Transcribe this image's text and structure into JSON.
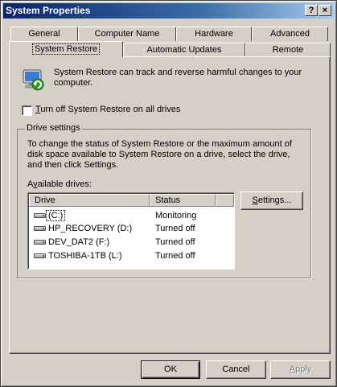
{
  "window": {
    "title": "System Properties",
    "help_glyph": "?",
    "close_glyph": "×"
  },
  "tabs": {
    "row_back": [
      {
        "label": "General"
      },
      {
        "label": "Computer Name"
      },
      {
        "label": "Hardware"
      },
      {
        "label": "Advanced"
      }
    ],
    "row_front": [
      {
        "label": "System Restore",
        "active": true
      },
      {
        "label": "Automatic Updates"
      },
      {
        "label": "Remote"
      }
    ]
  },
  "intro": {
    "icon": "system-restore-icon",
    "text": "System Restore can track and reverse harmful changes to your computer."
  },
  "turn_off": {
    "checked": false,
    "mnemonic": "T",
    "label_rest": "urn off System Restore on all drives"
  },
  "drive_settings": {
    "title": "Drive settings",
    "description": "To change the status of System Restore or the maximum amount of disk space available to System Restore on a drive, select the drive, and then click Settings.",
    "available_prefix": "A",
    "available_mnemonic": "v",
    "available_rest": "ailable drives:",
    "columns": {
      "drive": "Drive",
      "status": "Status"
    },
    "drives": [
      {
        "name": "(C:)",
        "status": "Monitoring",
        "selected": true
      },
      {
        "name": "HP_RECOVERY (D:)",
        "status": "Turned off"
      },
      {
        "name": "DEV_DAT2 (F:)",
        "status": "Turned off"
      },
      {
        "name": "TOSHIBA-1TB (L:)",
        "status": "Turned off"
      }
    ],
    "settings_mnemonic": "S",
    "settings_rest": "ettings..."
  },
  "footer": {
    "ok": "OK",
    "cancel": "Cancel",
    "apply_mnemonic": "A",
    "apply_rest": "pply",
    "apply_enabled": false
  }
}
